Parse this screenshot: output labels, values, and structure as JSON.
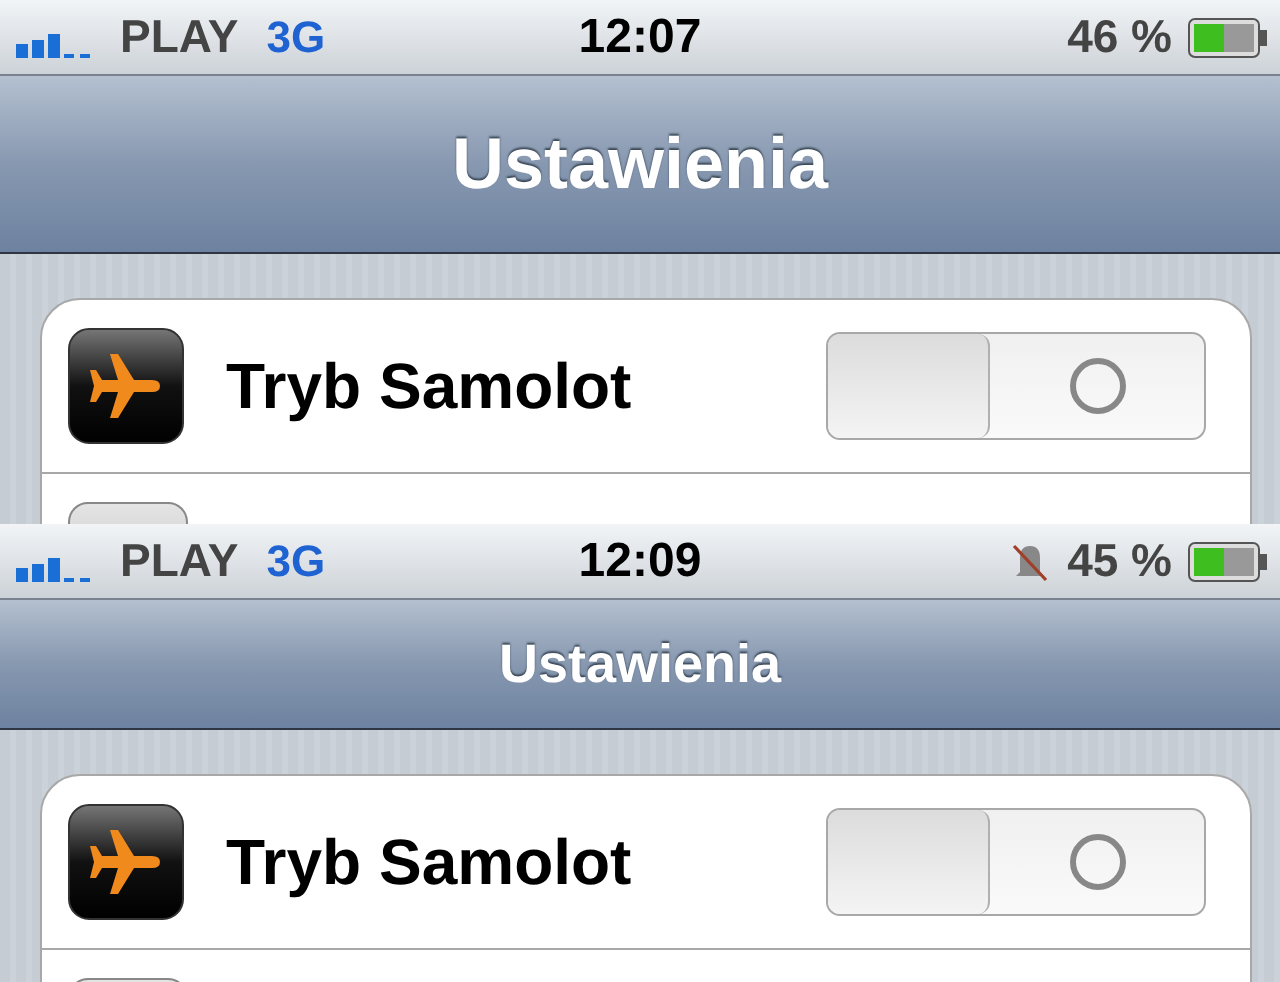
{
  "screens": [
    {
      "status": {
        "carrier": "PLAY",
        "network": "3G",
        "time": "12:07",
        "muted": false,
        "battery": "46 %"
      },
      "nav": {
        "title": "Ustawienia",
        "kind": "large"
      },
      "rows": [
        {
          "kind": "toggle",
          "label": "Tryb Samolot",
          "on": false
        },
        {
          "kind": "stub"
        }
      ]
    },
    {
      "status": {
        "carrier": "PLAY",
        "network": "3G",
        "time": "12:09",
        "muted": true,
        "battery": "45 %"
      },
      "nav": {
        "title": "Ustawienia",
        "kind": "compact"
      },
      "rows": [
        {
          "kind": "toggle",
          "label": "Tryb Samolot",
          "on": false
        },
        {
          "kind": "stub"
        }
      ]
    }
  ]
}
